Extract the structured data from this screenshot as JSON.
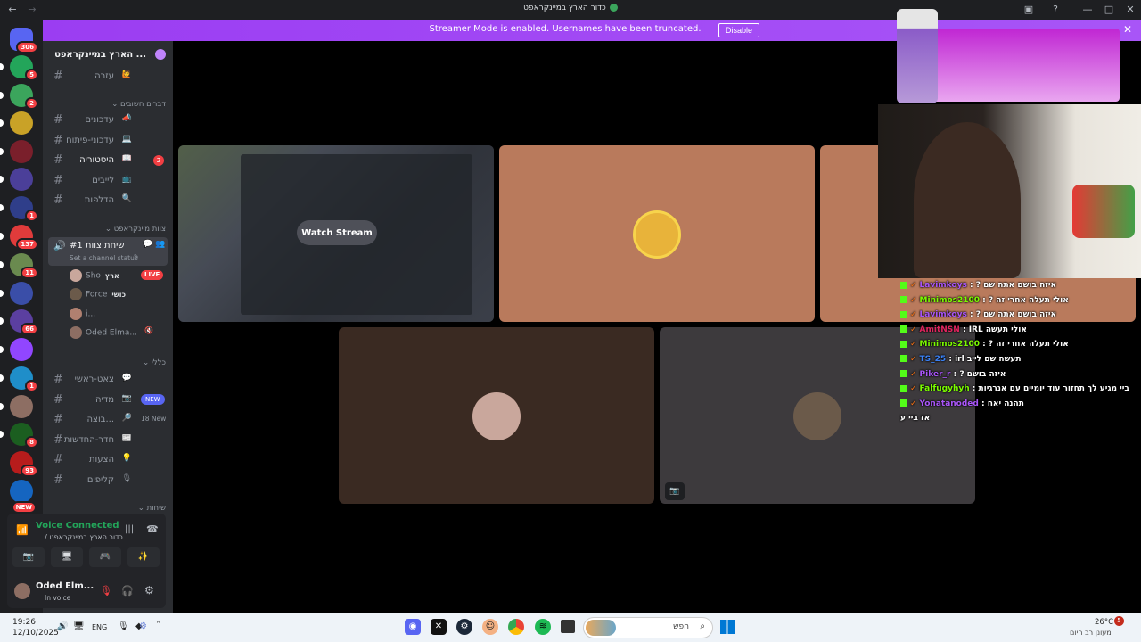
{
  "window": {
    "title": "כדור הארץ במיינקראפט"
  },
  "banner": {
    "message": "Streamer Mode is enabled. Usernames have been truncated.",
    "disable_label": "Disable"
  },
  "servers": [
    {
      "badge": "306",
      "color": "#5865f2"
    },
    {
      "badge": "5",
      "color": "#23a55a"
    },
    {
      "badge": "2",
      "color": "#3ba55c"
    },
    {
      "badge": "",
      "color": "#c9a227"
    },
    {
      "badge": "",
      "color": "#7a1f2b"
    },
    {
      "badge": "",
      "color": "#4b3f99"
    },
    {
      "badge": "1",
      "color": "#2f3e8a"
    },
    {
      "badge": "137",
      "color": "#e03b3b"
    },
    {
      "badge": "11",
      "color": "#6a8a4f"
    },
    {
      "badge": "",
      "color": "#3a4ea8"
    },
    {
      "badge": "66",
      "color": "#5b3fa0"
    },
    {
      "badge": "",
      "color": "#9146ff"
    },
    {
      "badge": "1",
      "color": "#1f8ec9"
    },
    {
      "badge": "",
      "color": "#8d6e63"
    },
    {
      "badge": "8",
      "color": "#1b5e20"
    },
    {
      "badge": "93",
      "color": "#b71c1c"
    },
    {
      "badge": "NEW",
      "color": "#1565c0"
    }
  ],
  "sidebar": {
    "server_name": "... הארץ במיינקראפט",
    "channels_top": [
      {
        "emoji": "🙋",
        "name": "עזרה"
      }
    ],
    "category_important": "דברים חשובים",
    "channels_important": [
      {
        "emoji": "📣",
        "name": "עדכונים",
        "unread": false,
        "badge": ""
      },
      {
        "emoji": "💻",
        "name": "עדכוני-פיתוח",
        "unread": false,
        "badge": ""
      },
      {
        "emoji": "📖",
        "name": "היסטוריה",
        "unread": true,
        "badge": "2"
      },
      {
        "emoji": "📺",
        "name": "לייבים",
        "unread": false,
        "badge": ""
      },
      {
        "emoji": "🔍",
        "name": "הדלפות",
        "unread": false,
        "badge": ""
      }
    ],
    "category_voice": "צוות מיינקראפט",
    "voice_channel": {
      "name": "שיחת צוות #1",
      "status": "Set a channel status"
    },
    "voice_users": [
      {
        "name": "Sho",
        "tag": "ארץ",
        "live": "LIVE"
      },
      {
        "name": "Force",
        "tag": "כושי",
        "live": ""
      },
      {
        "name": "i...",
        "tag": "",
        "live": ""
      },
      {
        "name": "Oded Elma...",
        "tag": "",
        "live": ""
      }
    ],
    "category_general": "כללי",
    "channels_general": [
      {
        "emoji": "💬",
        "name": "צאט-ראשי",
        "badge": ""
      },
      {
        "emoji": "📷",
        "name": "מדיה",
        "badge": "NEW"
      },
      {
        "emoji": "🔎",
        "name": "...בוצה",
        "badge": "18 New"
      },
      {
        "emoji": "📰",
        "name": "חדר-החדשות",
        "badge": ""
      },
      {
        "emoji": "💡",
        "name": "הצעות",
        "badge": ""
      },
      {
        "emoji": "🎙",
        "name": "קליפים",
        "badge": ""
      }
    ],
    "category_calls": "שיחות"
  },
  "voice_panel": {
    "status": "Voice Connected",
    "channel": "כדור הארץ במיינקראפט / ...",
    "user": "Oded Elm...",
    "user_status": "In voice"
  },
  "stage": {
    "watch_stream_label": "Watch Stream"
  },
  "chat": [
    {
      "name": "Lavimkoys",
      "color": "#a855f7",
      "text": "איזה בושם אתה שם ?"
    },
    {
      "name": "Minimos2100",
      "color": "#7cfc00",
      "text": "אולי תעלה אחרי זה ?"
    },
    {
      "name": "Lavimkoys",
      "color": "#a855f7",
      "text": "איזה בושם אתה שם ?"
    },
    {
      "name": "AmitNSN",
      "color": "#e0245e",
      "text": "אולי תעשה IRL"
    },
    {
      "name": "Minimos2100",
      "color": "#7cfc00",
      "text": "אולי תעלה אחרי זה ?"
    },
    {
      "name": "TS_25",
      "color": "#3b82f6",
      "text": "תעשה שם לייב irl"
    },
    {
      "name": "Piker_r",
      "color": "#a855f7",
      "text": "איזה בושם ?"
    },
    {
      "name": "Falfugyhyh",
      "color": "#7cfc00",
      "text": "ביי מגיע לך תחזור עוד יומיים עם אנרגיות"
    },
    {
      "name": "Yonatanoded",
      "color": "#a855f7",
      "text": "תהנה יאח"
    },
    {
      "name": "",
      "color": "#ffffff",
      "text": "אז ביי ע"
    }
  ],
  "taskbar": {
    "time": "19:26",
    "date": "12/10/2025",
    "lang": "ENG",
    "search": "חפש",
    "weather_temp": "26°C",
    "weather_desc": "מעונן רב היום",
    "weather_badge": "5"
  }
}
